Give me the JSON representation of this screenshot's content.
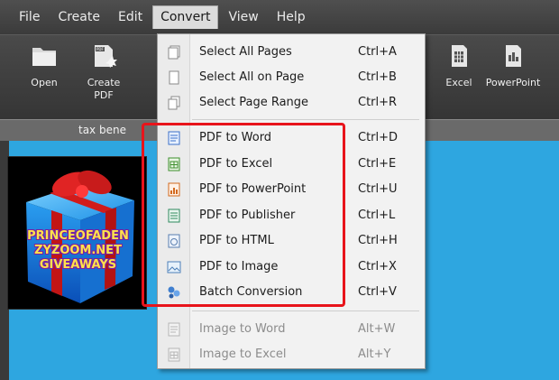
{
  "menubar": {
    "items": [
      "File",
      "Create",
      "Edit",
      "Convert",
      "View",
      "Help"
    ],
    "active_index": 3
  },
  "toolbar": {
    "open_label": "Open",
    "create_label": "Create\nPDF",
    "excel_label": "Excel",
    "powerpoint_label": "PowerPoint"
  },
  "doc_tabs": {
    "tab_label": "tax bene"
  },
  "overlay": {
    "line1": "PRINCEOFADEN",
    "line2": "ZYZOOM.NET",
    "line3": "GIVEAWAYS"
  },
  "dropdown": {
    "items": [
      {
        "label": "Select All Pages",
        "shortcut": "Ctrl+A",
        "icon": "pages-icon",
        "enabled": true
      },
      {
        "label": "Select All on Page",
        "shortcut": "Ctrl+B",
        "icon": "page-icon",
        "enabled": true
      },
      {
        "label": "Select Page Range",
        "shortcut": "Ctrl+R",
        "icon": "pages-range-icon",
        "enabled": true
      },
      {
        "label": "PDF to Word",
        "shortcut": "Ctrl+D",
        "icon": "word-doc-icon",
        "enabled": true
      },
      {
        "label": "PDF to Excel",
        "shortcut": "Ctrl+E",
        "icon": "excel-doc-icon",
        "enabled": true
      },
      {
        "label": "PDF to PowerPoint",
        "shortcut": "Ctrl+U",
        "icon": "powerpoint-doc-icon",
        "enabled": true
      },
      {
        "label": "PDF to Publisher",
        "shortcut": "Ctrl+L",
        "icon": "publisher-doc-icon",
        "enabled": true
      },
      {
        "label": "PDF to HTML",
        "shortcut": "Ctrl+H",
        "icon": "html-doc-icon",
        "enabled": true
      },
      {
        "label": "PDF to Image",
        "shortcut": "Ctrl+X",
        "icon": "image-icon",
        "enabled": true
      },
      {
        "label": "Batch Conversion",
        "shortcut": "Ctrl+V",
        "icon": "batch-icon",
        "enabled": true
      },
      {
        "label": "Image to Word",
        "shortcut": "Alt+W",
        "icon": "image-word-icon",
        "enabled": false
      },
      {
        "label": "Image to Excel",
        "shortcut": "Alt+Y",
        "icon": "image-excel-icon",
        "enabled": false
      }
    ]
  },
  "colors": {
    "highlight": "#e8141b",
    "workspace": "#2ea6e0",
    "toolbar": "#3f3f3f"
  }
}
